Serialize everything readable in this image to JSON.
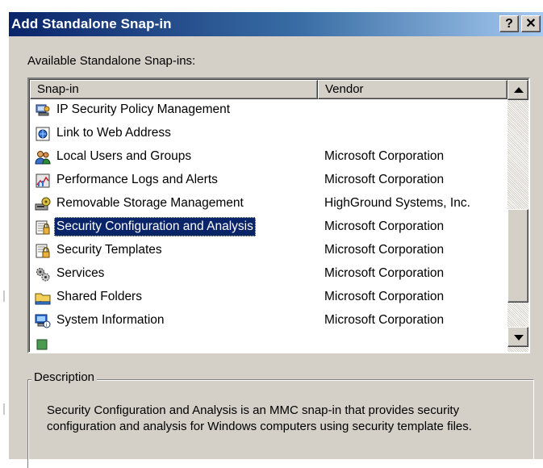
{
  "dialog": {
    "title": "Add Standalone Snap-in",
    "help_button": "?",
    "close_button": "✕"
  },
  "available_label": "Available Standalone Snap-ins:",
  "list": {
    "columns": [
      "Snap-in",
      "Vendor"
    ],
    "rows": [
      {
        "name": "IP Security Policy Management",
        "vendor": "",
        "icon": "ip-security-icon"
      },
      {
        "name": "Link to Web Address",
        "vendor": "",
        "icon": "web-link-icon"
      },
      {
        "name": "Local Users and Groups",
        "vendor": "Microsoft Corporation",
        "icon": "users-groups-icon"
      },
      {
        "name": "Performance Logs and Alerts",
        "vendor": "Microsoft Corporation",
        "icon": "performance-icon"
      },
      {
        "name": "Removable Storage Management",
        "vendor": "HighGround Systems, Inc.",
        "icon": "removable-storage-icon"
      },
      {
        "name": "Security Configuration and Analysis",
        "vendor": "Microsoft Corporation",
        "icon": "security-config-icon",
        "selected": true
      },
      {
        "name": "Security Templates",
        "vendor": "Microsoft Corporation",
        "icon": "security-templates-icon"
      },
      {
        "name": "Services",
        "vendor": "Microsoft Corporation",
        "icon": "services-gears-icon"
      },
      {
        "name": "Shared Folders",
        "vendor": "Microsoft Corporation",
        "icon": "shared-folders-icon"
      },
      {
        "name": "System Information",
        "vendor": "Microsoft Corporation",
        "icon": "system-info-icon"
      }
    ]
  },
  "description": {
    "legend": "Description",
    "text": "Security Configuration and  Analysis is an MMC snap-in that provides security configuration and analysis for Windows computers using security template files."
  },
  "colors": {
    "title_gradient_start": "#0a246a",
    "selection": "#0a246a",
    "face": "#d4d0c8"
  }
}
